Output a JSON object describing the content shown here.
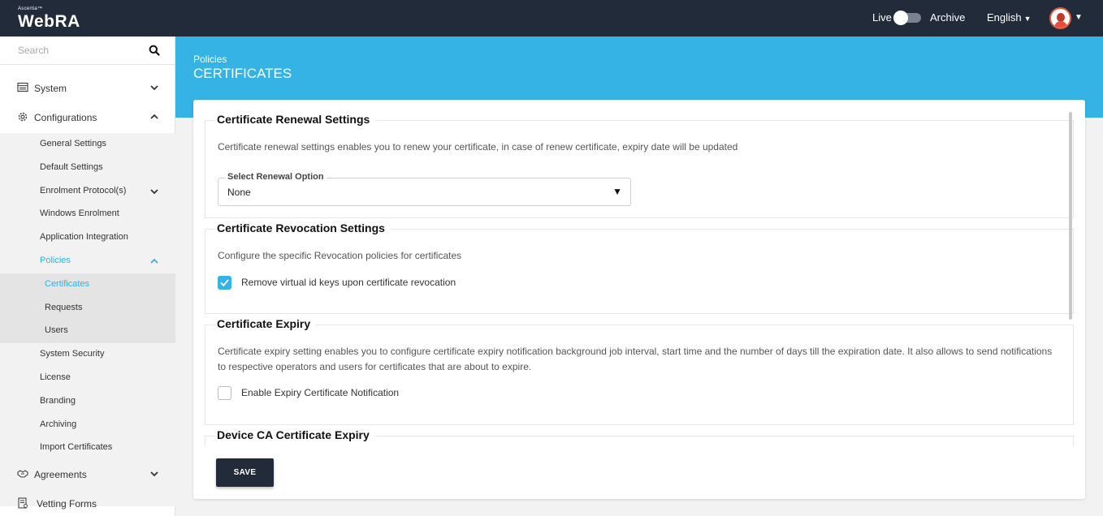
{
  "header": {
    "brand_small": "Ascertia™",
    "brand": "WebRA",
    "live_label": "Live",
    "archive_label": "Archive",
    "language": "English"
  },
  "sidebar": {
    "search_placeholder": "Search",
    "system": "System",
    "configurations": "Configurations",
    "config_items": {
      "general": "General Settings",
      "default": "Default Settings",
      "enrolment": "Enrolment Protocol(s)",
      "windows": "Windows Enrolment",
      "application": "Application Integration",
      "policies": "Policies",
      "system_security": "System Security",
      "license": "License",
      "branding": "Branding",
      "archiving": "Archiving",
      "import_certificates": "Import Certificates"
    },
    "policies_items": {
      "certificates": "Certificates",
      "requests": "Requests",
      "users": "Users"
    },
    "agreements": "Agreements",
    "vetting_forms": "Vetting Forms"
  },
  "banner": {
    "breadcrumb": "Policies",
    "title": "CERTIFICATES"
  },
  "sections": {
    "renewal": {
      "title": "Certificate Renewal Settings",
      "description": "Certificate renewal settings enables you to renew your certificate, in case of renew certificate, expiry date will be updated",
      "select_label": "Select Renewal Option",
      "select_value": "None"
    },
    "revocation": {
      "title": "Certificate Revocation Settings",
      "description": "Configure the specific Revocation policies for certificates",
      "checkbox_label": "Remove virtual id keys upon certificate revocation",
      "checked": true
    },
    "expiry": {
      "title": "Certificate Expiry",
      "description": "Certificate expiry setting enables you to configure certificate expiry notification background job interval, start time and the number of days till the expiration date. It also allows to send notifications to respective operators and users for certificates that are about to expire.",
      "checkbox_label": "Enable Expiry Certificate Notification",
      "checked": false
    },
    "device_ca": {
      "title": "Device CA Certificate Expiry"
    }
  },
  "save_label": "SAVE",
  "colors": {
    "topbar": "#222b3a",
    "accent": "#34b3e4",
    "active_link": "#2fb0e2"
  }
}
